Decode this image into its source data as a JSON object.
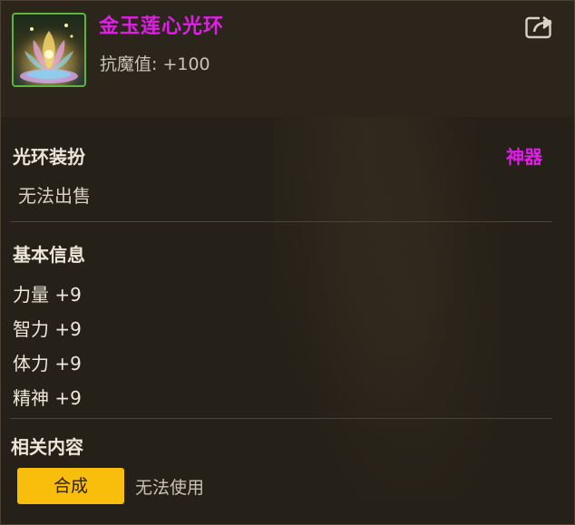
{
  "item": {
    "name": "金玉莲心光环",
    "stat": "抗魔值: +100",
    "name_color": "#e01ee8",
    "icon": "lotus-aura-icon"
  },
  "share_icon": "share-icon",
  "category": {
    "title": "光环装扮",
    "rarity": "神器",
    "sell_status": "无法出售"
  },
  "basic_info": {
    "title": "基本信息",
    "attributes": [
      "力量 +9",
      "智力 +9",
      "体力 +9",
      "精神 +9"
    ]
  },
  "related": {
    "title": "相关内容",
    "craft_label": "合成",
    "use_status": "无法使用",
    "craft_color": "#f9be0b"
  }
}
